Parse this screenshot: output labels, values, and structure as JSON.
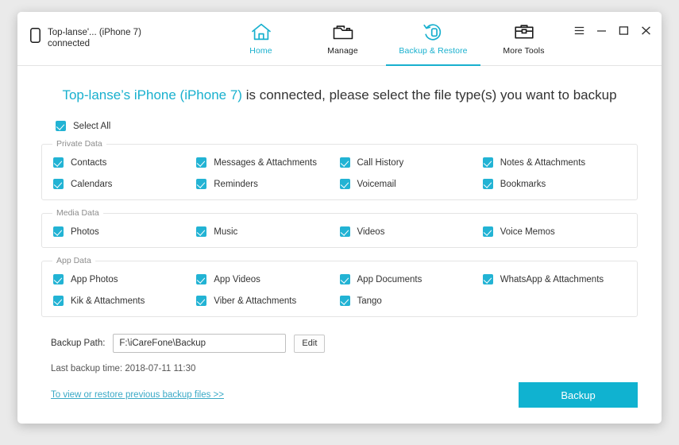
{
  "titlebar": {
    "device_name": "Top-lanse'... (iPhone 7)",
    "device_status": "connected",
    "device_icon": "phone-icon",
    "tabs": [
      {
        "label": "Home",
        "icon": "home-icon",
        "active": false
      },
      {
        "label": "Manage",
        "icon": "folder-icon",
        "active": false
      },
      {
        "label": "Backup & Restore",
        "icon": "backup-restore-icon",
        "active": true
      },
      {
        "label": "More Tools",
        "icon": "toolbox-icon",
        "active": false
      }
    ],
    "window_controls": [
      {
        "name": "menu",
        "glyph": "☰"
      },
      {
        "name": "minimize",
        "glyph": "–"
      },
      {
        "name": "maximize",
        "glyph": "☐"
      },
      {
        "name": "close",
        "glyph": "✕"
      }
    ]
  },
  "headline": {
    "device": "Top-lanse’s iPhone (iPhone 7)",
    "rest": "is connected, please select the file type(s) you want to backup"
  },
  "select_all": {
    "label": "Select All",
    "checked": true
  },
  "groups": [
    {
      "title": "Private Data",
      "items": [
        {
          "label": "Contacts",
          "checked": true
        },
        {
          "label": "Messages & Attachments",
          "checked": true
        },
        {
          "label": "Call History",
          "checked": true
        },
        {
          "label": "Notes & Attachments",
          "checked": true
        },
        {
          "label": "Calendars",
          "checked": true
        },
        {
          "label": "Reminders",
          "checked": true
        },
        {
          "label": "Voicemail",
          "checked": true
        },
        {
          "label": "Bookmarks",
          "checked": true
        }
      ]
    },
    {
      "title": "Media Data",
      "items": [
        {
          "label": "Photos",
          "checked": true
        },
        {
          "label": "Music",
          "checked": true
        },
        {
          "label": "Videos",
          "checked": true
        },
        {
          "label": "Voice Memos",
          "checked": true
        }
      ]
    },
    {
      "title": "App Data",
      "items": [
        {
          "label": "App Photos",
          "checked": true
        },
        {
          "label": "App Videos",
          "checked": true
        },
        {
          "label": "App Documents",
          "checked": true
        },
        {
          "label": "WhatsApp & Attachments",
          "checked": true
        },
        {
          "label": "Kik & Attachments",
          "checked": true
        },
        {
          "label": "Viber & Attachments",
          "checked": true
        },
        {
          "label": "Tango",
          "checked": true
        }
      ]
    }
  ],
  "backup_path": {
    "label": "Backup Path:",
    "value": "F:\\iCareFone\\Backup",
    "placeholder": "Backup path",
    "edit_label": "Edit"
  },
  "last_backup": "Last backup time: 2018-07-11 11:30",
  "footer": {
    "restore_link": "To view or restore previous backup files >>",
    "backup_button": "Backup"
  },
  "colors": {
    "accent": "#18b0ce",
    "checkbox": "#22b3d4",
    "button": "#10b2d0",
    "link": "#3aa9c6"
  }
}
